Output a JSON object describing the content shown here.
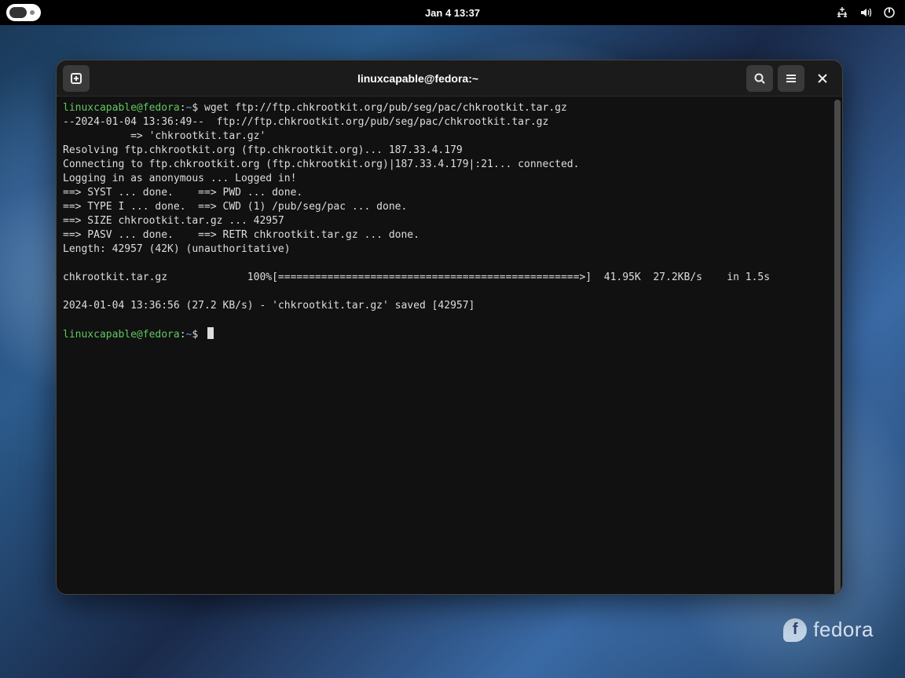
{
  "topbar": {
    "datetime": "Jan 4  13:37"
  },
  "terminal": {
    "title": "linuxcapable@fedora:~",
    "prompt_user": "linuxcapable@fedora",
    "prompt_sep": ":",
    "prompt_path": "~",
    "prompt_symbol": "$ ",
    "command": "wget ftp://ftp.chkrootkit.org/pub/seg/pac/chkrootkit.tar.gz",
    "output_lines": [
      "--2024-01-04 13:36:49--  ftp://ftp.chkrootkit.org/pub/seg/pac/chkrootkit.tar.gz",
      "           => 'chkrootkit.tar.gz'",
      "Resolving ftp.chkrootkit.org (ftp.chkrootkit.org)... 187.33.4.179",
      "Connecting to ftp.chkrootkit.org (ftp.chkrootkit.org)|187.33.4.179|:21... connected.",
      "Logging in as anonymous ... Logged in!",
      "==> SYST ... done.    ==> PWD ... done.",
      "==> TYPE I ... done.  ==> CWD (1) /pub/seg/pac ... done.",
      "==> SIZE chkrootkit.tar.gz ... 42957",
      "==> PASV ... done.    ==> RETR chkrootkit.tar.gz ... done.",
      "Length: 42957 (42K) (unauthoritative)",
      "",
      "chkrootkit.tar.gz             100%[=================================================>]  41.95K  27.2KB/s    in 1.5s",
      "",
      "2024-01-04 13:36:56 (27.2 KB/s) - 'chkrootkit.tar.gz' saved [42957]",
      ""
    ]
  },
  "branding": {
    "name": "fedora",
    "glyph": "f"
  }
}
